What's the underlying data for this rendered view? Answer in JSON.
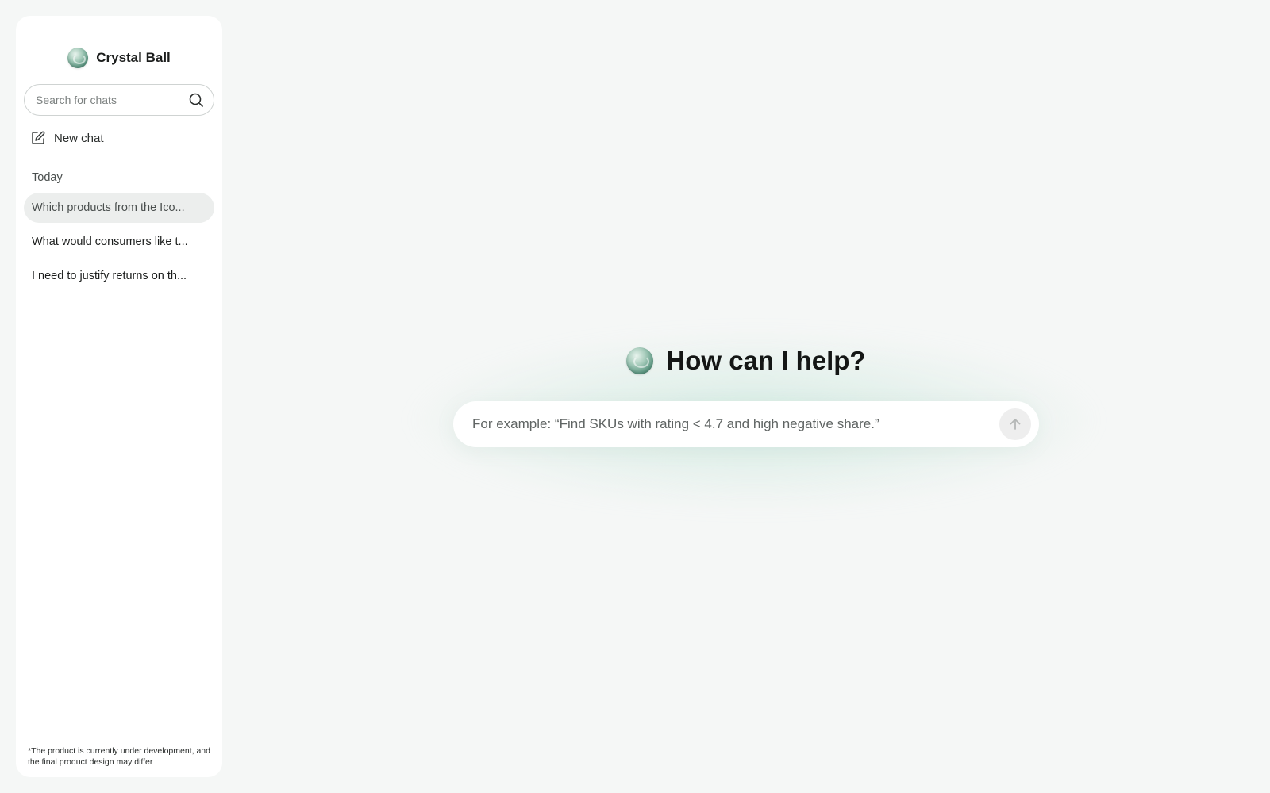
{
  "app": {
    "name": "Crystal Ball"
  },
  "sidebar": {
    "search": {
      "placeholder": "Search for chats",
      "icon": "search-icon"
    },
    "new_chat": {
      "label": "New chat",
      "icon": "edit-icon"
    },
    "section_label": "Today",
    "chats": [
      {
        "title": "Which products from the Ico...",
        "active": true
      },
      {
        "title": "What would consumers like t...",
        "active": false
      },
      {
        "title": "I need to justify returns on th...",
        "active": false
      }
    ],
    "disclaimer": "*The product is currently under development, and the final product design may differ"
  },
  "main": {
    "heading": "How can I help?",
    "prompt": {
      "placeholder": "For example: “Find SKUs with rating < 4.7 and high negative share.”",
      "send_icon": "arrow-up-icon"
    }
  },
  "colors": {
    "background": "#f5f7f6",
    "panel": "#ffffff",
    "accent": "#5f9984",
    "active_item": "#eceeed"
  }
}
